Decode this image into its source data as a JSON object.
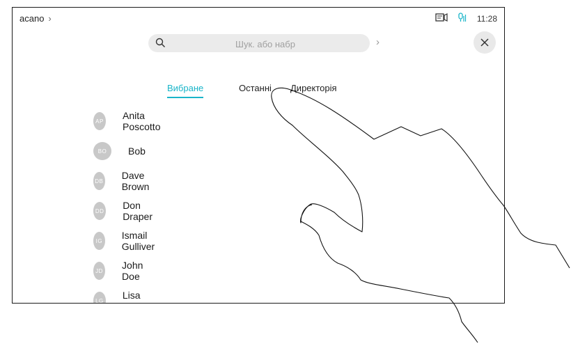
{
  "header": {
    "breadcrumb": "acano",
    "time": "11:28"
  },
  "icons": {
    "breadcrumb_chevron": "chevron-right-icon",
    "screen": "screen-share-icon",
    "mic": "microphone-icon",
    "search": "search-icon",
    "go": "chevron-right-icon",
    "close": "close-icon"
  },
  "search": {
    "placeholder": "Шук. або набр"
  },
  "tabs": [
    {
      "label": "Вибране",
      "active": true
    },
    {
      "label": "Останні",
      "active": false
    },
    {
      "label": "Директорія",
      "active": false
    }
  ],
  "contacts": [
    {
      "initials": "AP",
      "name": "Anita Poscotto"
    },
    {
      "initials": "BO",
      "name": "Bob"
    },
    {
      "initials": "DB",
      "name": "Dave Brown"
    },
    {
      "initials": "DD",
      "name": "Don Draper"
    },
    {
      "initials": "IG",
      "name": "Ismail Gulliver"
    },
    {
      "initials": "JD",
      "name": "John Doe"
    },
    {
      "initials": "LG",
      "name": "Lisa Green"
    }
  ],
  "colors": {
    "accent": "#19b5c9",
    "avatar": "#c8c8c8",
    "search_bg": "#ebebeb"
  }
}
